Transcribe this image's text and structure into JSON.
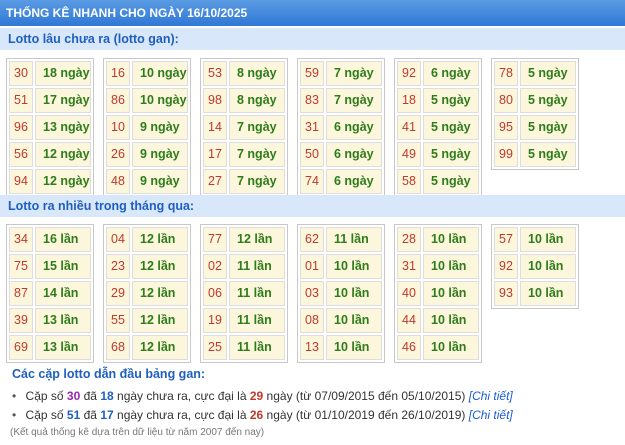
{
  "header": {
    "title": "THỐNG KÊ NHANH CHO NGÀY 16/10/2025"
  },
  "gan_section": {
    "title": "Lotto lâu chưa ra (lotto gan):",
    "columns": [
      [
        {
          "num": "30",
          "val": "18 ngày"
        },
        {
          "num": "51",
          "val": "17 ngày"
        },
        {
          "num": "96",
          "val": "13 ngày"
        },
        {
          "num": "56",
          "val": "12 ngày"
        },
        {
          "num": "94",
          "val": "12 ngày"
        }
      ],
      [
        {
          "num": "16",
          "val": "10 ngày"
        },
        {
          "num": "86",
          "val": "10 ngày"
        },
        {
          "num": "10",
          "val": "9 ngày"
        },
        {
          "num": "26",
          "val": "9 ngày"
        },
        {
          "num": "48",
          "val": "9 ngày"
        }
      ],
      [
        {
          "num": "53",
          "val": "8 ngày"
        },
        {
          "num": "98",
          "val": "8 ngày"
        },
        {
          "num": "14",
          "val": "7 ngày"
        },
        {
          "num": "17",
          "val": "7 ngày"
        },
        {
          "num": "27",
          "val": "7 ngày"
        }
      ],
      [
        {
          "num": "59",
          "val": "7 ngày"
        },
        {
          "num": "83",
          "val": "7 ngày"
        },
        {
          "num": "31",
          "val": "6 ngày"
        },
        {
          "num": "50",
          "val": "6 ngày"
        },
        {
          "num": "74",
          "val": "6 ngày"
        }
      ],
      [
        {
          "num": "92",
          "val": "6 ngày"
        },
        {
          "num": "18",
          "val": "5 ngày"
        },
        {
          "num": "41",
          "val": "5 ngày"
        },
        {
          "num": "49",
          "val": "5 ngày"
        },
        {
          "num": "58",
          "val": "5 ngày"
        }
      ],
      [
        {
          "num": "78",
          "val": "5 ngày"
        },
        {
          "num": "80",
          "val": "5 ngày"
        },
        {
          "num": "95",
          "val": "5 ngày"
        },
        {
          "num": "99",
          "val": "5 ngày"
        }
      ]
    ]
  },
  "freq_section": {
    "title": "Lotto ra nhiều trong tháng qua:",
    "columns": [
      [
        {
          "num": "34",
          "val": "16 lần"
        },
        {
          "num": "75",
          "val": "15 lần"
        },
        {
          "num": "87",
          "val": "14 lần"
        },
        {
          "num": "39",
          "val": "13 lần"
        },
        {
          "num": "69",
          "val": "13 lần"
        }
      ],
      [
        {
          "num": "04",
          "val": "12 lần"
        },
        {
          "num": "23",
          "val": "12 lần"
        },
        {
          "num": "29",
          "val": "12 lần"
        },
        {
          "num": "55",
          "val": "12 lần"
        },
        {
          "num": "68",
          "val": "12 lần"
        }
      ],
      [
        {
          "num": "77",
          "val": "12 lần"
        },
        {
          "num": "02",
          "val": "11 lần"
        },
        {
          "num": "06",
          "val": "11 lần"
        },
        {
          "num": "19",
          "val": "11 lần"
        },
        {
          "num": "25",
          "val": "11 lần"
        }
      ],
      [
        {
          "num": "62",
          "val": "11 lần"
        },
        {
          "num": "01",
          "val": "10 lần"
        },
        {
          "num": "03",
          "val": "10 lần"
        },
        {
          "num": "08",
          "val": "10 lần"
        },
        {
          "num": "13",
          "val": "10 lần"
        }
      ],
      [
        {
          "num": "28",
          "val": "10 lần"
        },
        {
          "num": "31",
          "val": "10 lần"
        },
        {
          "num": "40",
          "val": "10 lần"
        },
        {
          "num": "44",
          "val": "10 lần"
        },
        {
          "num": "46",
          "val": "10 lần"
        }
      ],
      [
        {
          "num": "57",
          "val": "10 lần"
        },
        {
          "num": "92",
          "val": "10 lần"
        },
        {
          "num": "93",
          "val": "10 lần"
        }
      ]
    ]
  },
  "summary": {
    "title": "Các cặp lotto dẫn đầu bảng gan:",
    "pairs": [
      {
        "prefix": "Cặp số",
        "num": "30",
        "mid1": "đã",
        "days": "18",
        "mid2": "ngày chưa ra, cực đại là",
        "max": "29",
        "suffix": "ngày (từ 07/09/2015 đến 05/10/2015)",
        "link": "[Chi tiết]"
      },
      {
        "prefix": "Cặp số",
        "num": "51",
        "mid1": "đã",
        "days": "17",
        "mid2": "ngày chưa ra, cực đại là",
        "max": "26",
        "suffix": "ngày (từ 01/10/2019 đến 26/10/2019)",
        "link": "[Chi tiết]"
      }
    ],
    "footnote": "(Kết quả thống kê dựa trên dữ liệu từ năm 2007 đến nay)"
  },
  "colors": {
    "header_bg": "#2f78d6",
    "section_bg": "#d9e7fa",
    "cell_bg": "#fbf6dc",
    "number_red": "#c0392b",
    "value_green": "#2e7d1a",
    "link_blue": "#1a5dd6"
  }
}
